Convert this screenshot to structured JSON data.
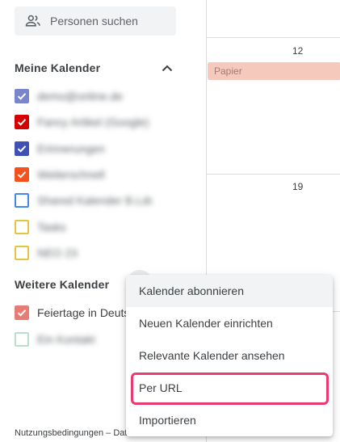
{
  "search": {
    "placeholder": "Personen suchen"
  },
  "my_calendars": {
    "heading": "Meine Kalender",
    "items": [
      {
        "label": "demo@online.de",
        "color": "#7986cb",
        "checked": true
      },
      {
        "label": "Fancy Artikel (Google)",
        "color": "#d50000",
        "checked": true
      },
      {
        "label": "Erinnerungen",
        "color": "#3f51b5",
        "checked": true
      },
      {
        "label": "Weiterschnell",
        "color": "#f4511e",
        "checked": true
      },
      {
        "label": "Shared Kalender B.Ldr.",
        "color": "#4285f4",
        "checked": false
      },
      {
        "label": "Tasks",
        "color": "#e4c441",
        "checked": false
      },
      {
        "label": "NEO 23",
        "color": "#e4c441",
        "checked": false
      }
    ]
  },
  "other_calendars": {
    "heading": "Weitere Kalender",
    "items": [
      {
        "label": "Feiertage in Deutschland",
        "color": "#e67c73",
        "checked": true
      },
      {
        "label": "Ein Kontakt",
        "color": "#b7e1cd",
        "checked": false
      }
    ]
  },
  "footer": {
    "text": "Nutzungsbedingungen – Datenschutz"
  },
  "grid": {
    "days": [
      "12",
      "19"
    ],
    "event": "Papier"
  },
  "menu": {
    "items": [
      "Kalender abonnieren",
      "Neuen Kalender einrichten",
      "Relevante Kalender ansehen",
      "Per URL",
      "Importieren"
    ],
    "highlighted_index": 3
  }
}
